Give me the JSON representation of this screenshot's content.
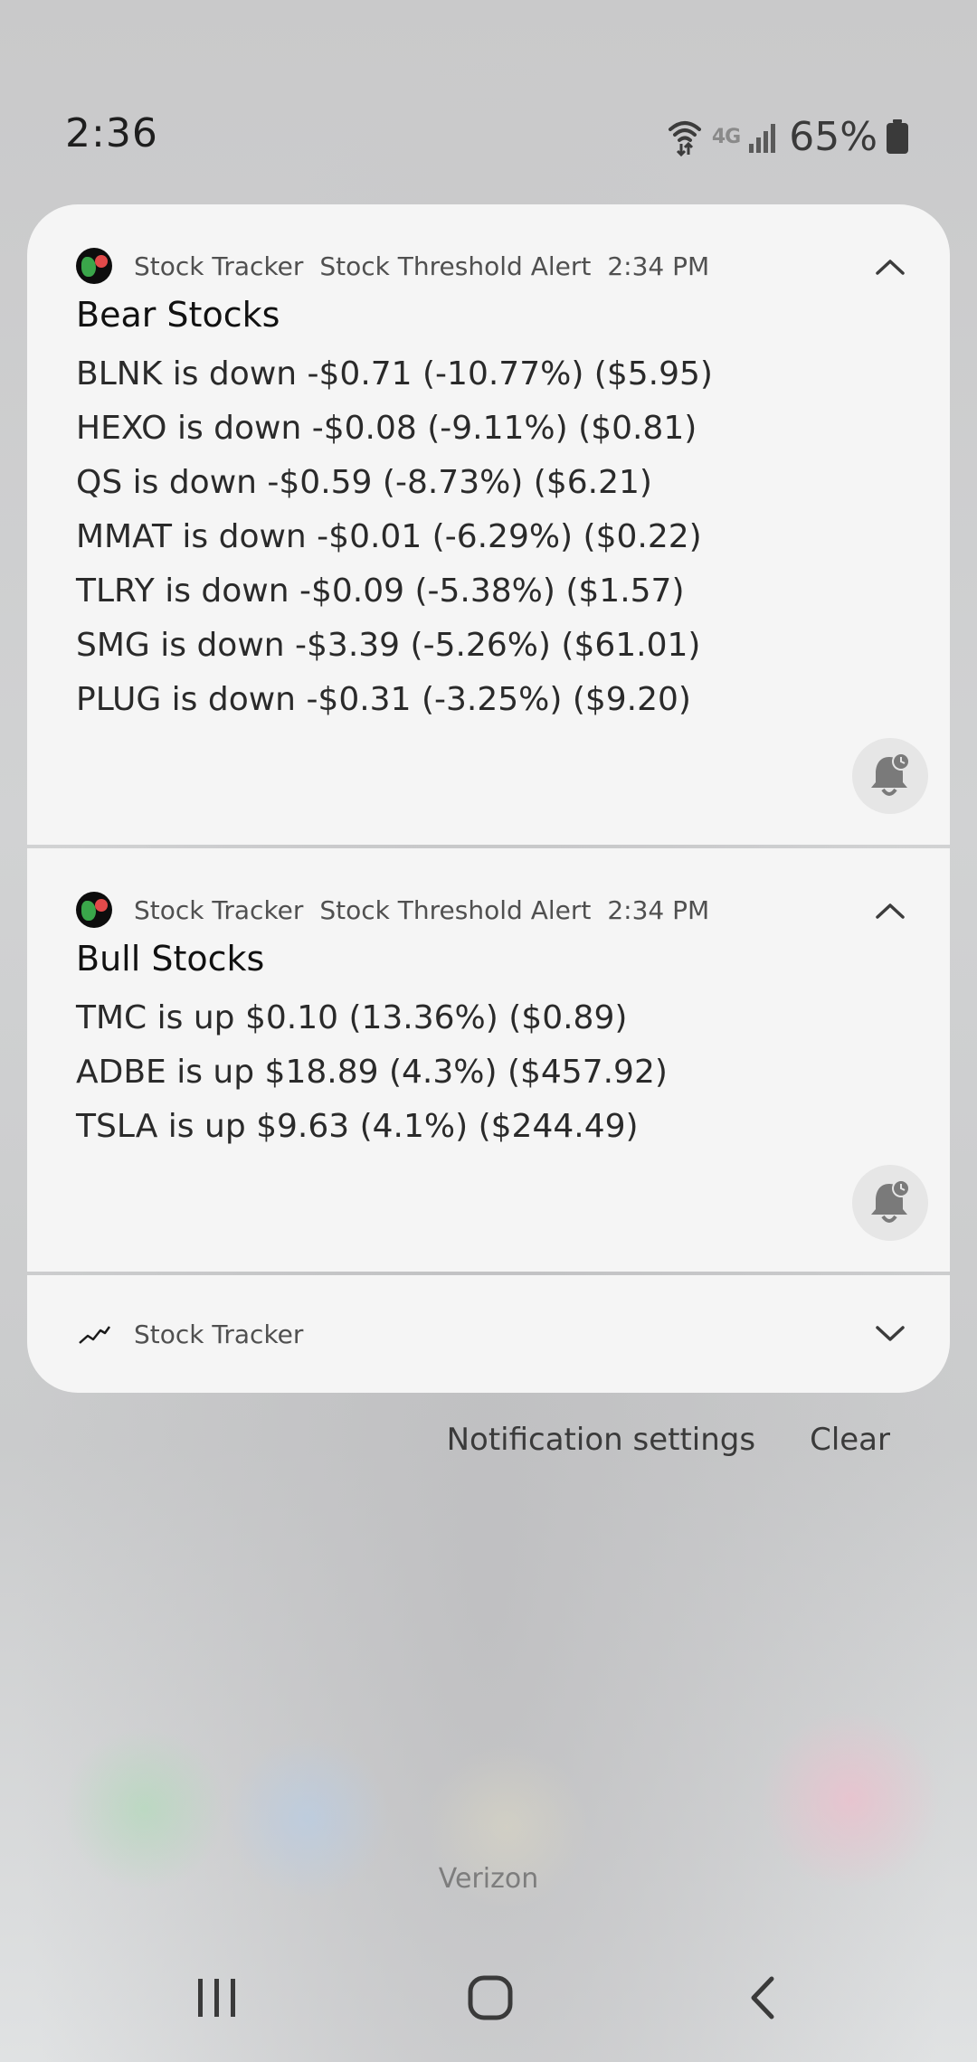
{
  "status_bar": {
    "time": "2:36",
    "network": "4G",
    "battery": "65%"
  },
  "notifications": [
    {
      "app": "Stock Tracker",
      "channel": "Stock Threshold Alert",
      "time": "2:34 PM",
      "title": "Bear Stocks",
      "lines": [
        "BLNK is down -$0.71 (-10.77%) ($5.95)",
        "HEXO is down -$0.08 (-9.11%) ($0.81)",
        "QS is down -$0.59 (-8.73%) ($6.21)",
        "MMAT is down -$0.01 (-6.29%) ($0.22)",
        "TLRY is down -$0.09 (-5.38%) ($1.57)",
        "SMG is down -$3.39 (-5.26%) ($61.01)",
        "PLUG is down -$0.31 (-3.25%) ($9.20)"
      ]
    },
    {
      "app": "Stock Tracker",
      "channel": "Stock Threshold Alert",
      "time": "2:34 PM",
      "title": "Bull Stocks",
      "lines": [
        "TMC is up $0.10 (13.36%) ($0.89)",
        "ADBE is up $18.89 (4.3%) ($457.92)",
        "TSLA is up $9.63 (4.1%) ($244.49)"
      ]
    },
    {
      "app": "Stock Tracker"
    }
  ],
  "actions": {
    "settings": "Notification settings",
    "clear": "Clear"
  },
  "carrier": "Verizon",
  "icons": {
    "wifi": "wifi-calling-icon",
    "signal": "signal-bars-icon",
    "battery": "battery-icon",
    "expand": "chevron-up-icon",
    "collapse": "chevron-down-icon",
    "snooze": "snooze-bell-icon",
    "recents": "recents-icon",
    "home": "home-icon",
    "back": "back-icon"
  }
}
